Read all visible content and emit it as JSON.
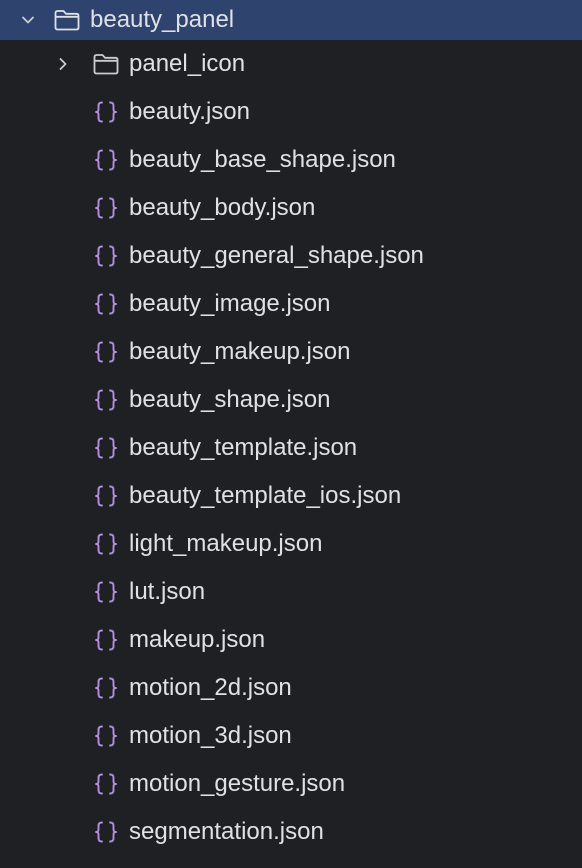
{
  "tree": {
    "root_folder": {
      "name": "beauty_panel",
      "expanded": true,
      "chevron_icon": "chevron-down-icon",
      "folder_icon": "folder-icon"
    },
    "sub_folder": {
      "name": "panel_icon",
      "expanded": false,
      "chevron_icon": "chevron-right-icon",
      "folder_icon": "folder-icon"
    },
    "files": [
      {
        "name": "beauty.json",
        "icon": "json-braces-icon"
      },
      {
        "name": "beauty_base_shape.json",
        "icon": "json-braces-icon"
      },
      {
        "name": "beauty_body.json",
        "icon": "json-braces-icon"
      },
      {
        "name": "beauty_general_shape.json",
        "icon": "json-braces-icon"
      },
      {
        "name": "beauty_image.json",
        "icon": "json-braces-icon"
      },
      {
        "name": "beauty_makeup.json",
        "icon": "json-braces-icon"
      },
      {
        "name": "beauty_shape.json",
        "icon": "json-braces-icon"
      },
      {
        "name": "beauty_template.json",
        "icon": "json-braces-icon"
      },
      {
        "name": "beauty_template_ios.json",
        "icon": "json-braces-icon"
      },
      {
        "name": "light_makeup.json",
        "icon": "json-braces-icon"
      },
      {
        "name": "lut.json",
        "icon": "json-braces-icon"
      },
      {
        "name": "makeup.json",
        "icon": "json-braces-icon"
      },
      {
        "name": "motion_2d.json",
        "icon": "json-braces-icon"
      },
      {
        "name": "motion_3d.json",
        "icon": "json-braces-icon"
      },
      {
        "name": "motion_gesture.json",
        "icon": "json-braces-icon"
      },
      {
        "name": "segmentation.json",
        "icon": "json-braces-icon"
      }
    ]
  },
  "colors": {
    "background": "#1f2023",
    "selected_row": "#2e436e",
    "text": "#dfe1e5",
    "json_icon": "#b18ee0",
    "folder_outline": "#c9ccd1"
  }
}
